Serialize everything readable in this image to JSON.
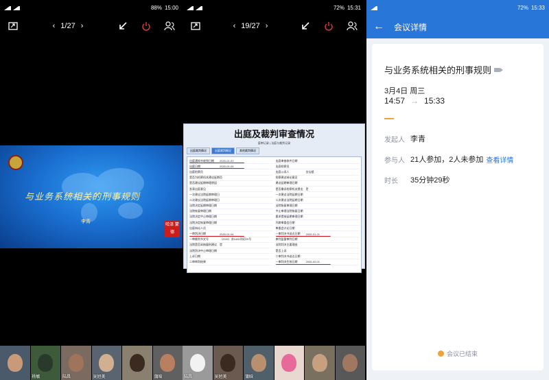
{
  "panel1": {
    "status": {
      "time": "15:00",
      "battery": "88%",
      "network": "4G"
    },
    "pager": {
      "page": "1/27"
    },
    "slide": {
      "title": "与业务系统相关的刑事规则",
      "presenter": "李青",
      "seal": "哈泽 蒙德"
    },
    "participants": [
      "",
      "杨敏",
      "陆昌",
      "吴旭美",
      "",
      "蒲晗"
    ]
  },
  "panel2": {
    "status": {
      "time": "15:31",
      "battery": "72%",
      "network": "4G"
    },
    "pager": {
      "page": "19/27"
    },
    "slide": {
      "title": "出庭及裁判审查情况",
      "subtitle": "庭审记录 | 法庭与裁判记录",
      "tabs": [
        "出庭裁判情况",
        "出庭裁判概况",
        "其他裁判情况"
      ],
      "left_rows": [
        {
          "label": "出庭通知书收到日期",
          "value": "2020-01-03"
        },
        {
          "label": "出庭日期",
          "value": "2020-01-04"
        },
        {
          "label": "出庭检察员",
          "value": ""
        },
        {
          "label": "是否为检察机关建议延期审理",
          "value": "否"
        },
        {
          "label": "是否建议延期审理原因",
          "value": ""
        },
        {
          "label": "发表出庭意见",
          "value": ""
        },
        {
          "label": "一次建议法院延期审理日期",
          "value": ""
        },
        {
          "label": "二次建议法院延期审理日期",
          "value": ""
        },
        {
          "label": "法院决定延期审理日期",
          "value": ""
        },
        {
          "label": "法院恢复审理日期",
          "value": ""
        },
        {
          "label": "法院决定中止审理日期",
          "value": ""
        },
        {
          "label": "法院决定恢复审理日期",
          "value": ""
        },
        {
          "label": "出庭辩论人员",
          "value": ""
        },
        {
          "label": "一审判决日期",
          "value": "2020-01-04"
        },
        {
          "label": "一审裁判书文号",
          "value": "（2020）苏0481刑初29号"
        },
        {
          "label": "法院是否采纳量刑建议",
          "value": "是"
        },
        {
          "label": "法院判决中止审理日期",
          "value": ""
        },
        {
          "label": "上诉日期",
          "value": ""
        },
        {
          "label": "二审审判结果",
          "value": ""
        }
      ],
      "right_rows": [
        {
          "label": "出庭审查收件日期",
          "value": ""
        },
        {
          "label": "出庭检察员",
          "value": ""
        },
        {
          "label": "出庭公诉人",
          "value": "金仙楼"
        },
        {
          "label": "检察建议辩论意见",
          "value": ""
        },
        {
          "label": "建议延期审理日期",
          "value": ""
        },
        {
          "label": "是否撤诉检察机关提出",
          "value": "是"
        },
        {
          "label": "一次建议法院延期日期",
          "value": ""
        },
        {
          "label": "二次建议法院延期日期",
          "value": ""
        },
        {
          "label": "法院恢复审理日期",
          "value": ""
        },
        {
          "label": "中止审理法院恢复日期",
          "value": ""
        },
        {
          "label": "要求提前延期审理日期",
          "value": ""
        },
        {
          "label": "列席审委会日期",
          "value": ""
        },
        {
          "label": "审委会讨论日期",
          "value": ""
        },
        {
          "label": "一审判决书送达日期",
          "value": "2020-01-21"
        },
        {
          "label": "审判监督审判日期",
          "value": ""
        },
        {
          "label": "法院判决主要理由",
          "value": ""
        },
        {
          "label": "是否上诉",
          "value": ""
        },
        {
          "label": "二审判决书送达日期",
          "value": ""
        },
        {
          "label": "一审判决生效日期",
          "value": "2020-02-01"
        }
      ]
    },
    "participants": [
      "陆昌",
      "吴旭美",
      "蒲晗",
      "",
      "",
      ""
    ]
  },
  "panel3": {
    "status": {
      "time": "15:33",
      "battery": "72%",
      "network": "4G"
    },
    "header": {
      "back": "←",
      "title": "会议详情"
    },
    "meeting": {
      "title": "与业务系统相关的刑事规则",
      "date": "3月4日 周三",
      "start": "14:57",
      "arrow": "→",
      "end": "15:33"
    },
    "host": {
      "label": "发起人",
      "value": "李青"
    },
    "attendees": {
      "label": "参与人",
      "value": "21人参加，2人未参加",
      "link": "查看详情"
    },
    "duration": {
      "label": "时长",
      "value": "35分钟29秒"
    },
    "ended": "会议已结束"
  },
  "colors": {
    "accent": "#2876d8",
    "orange": "#f0a23a",
    "red_underline": "#d0101c"
  }
}
